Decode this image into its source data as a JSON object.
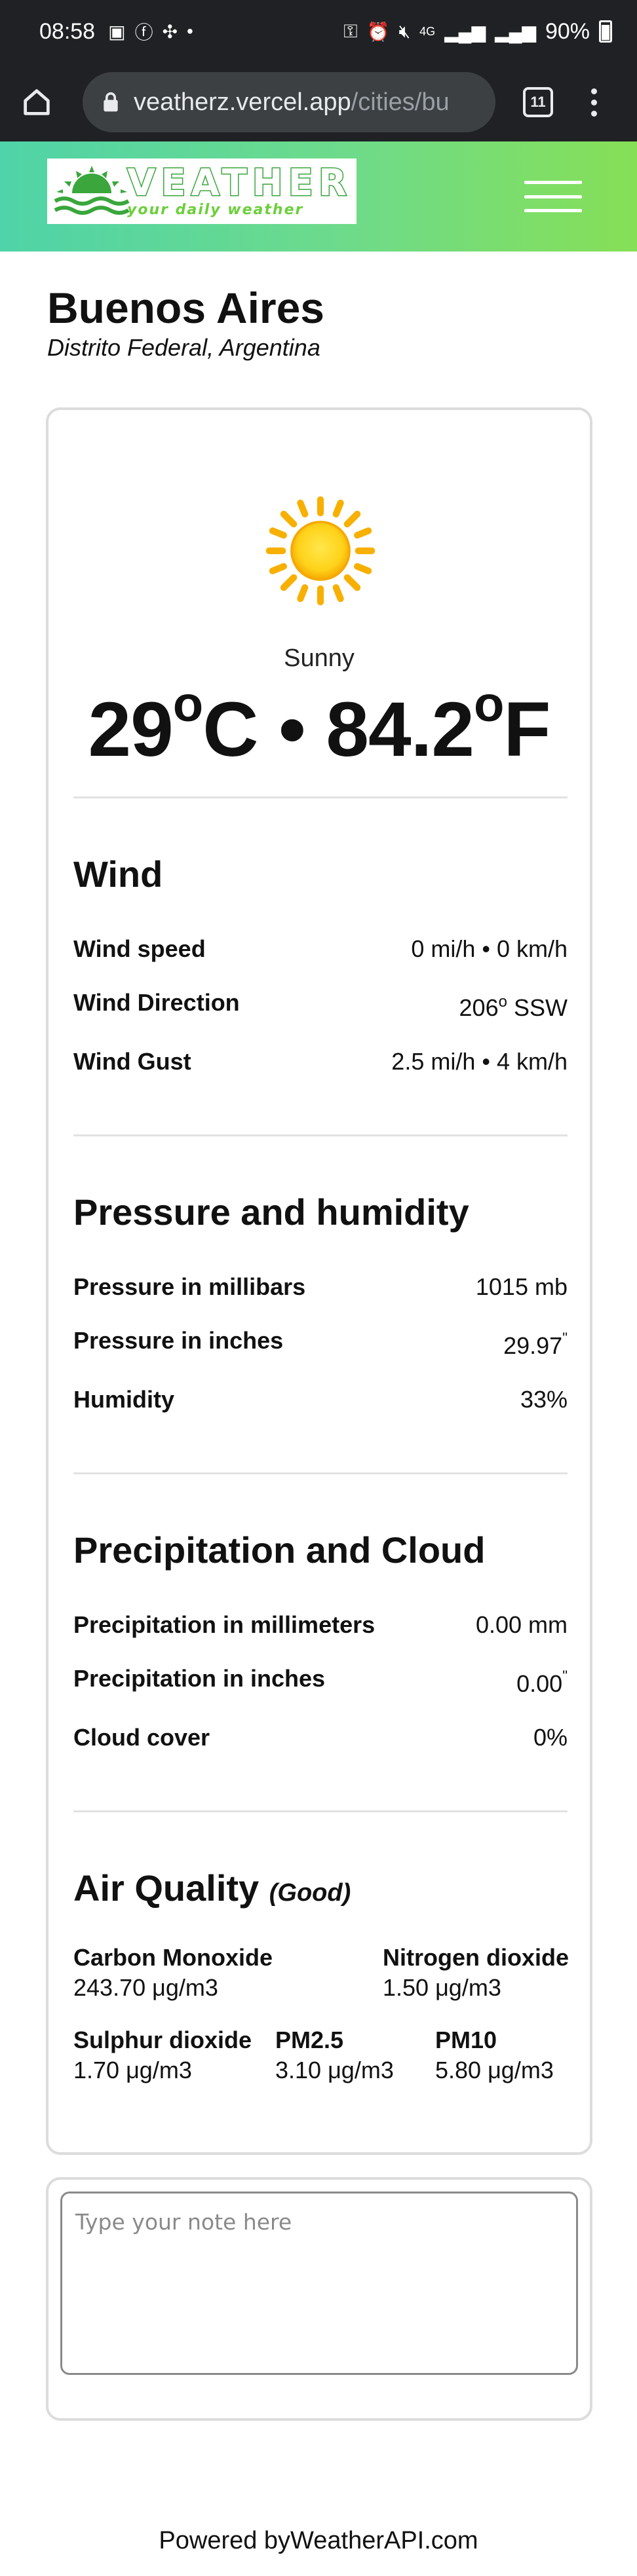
{
  "status_bar": {
    "time": "08:58",
    "battery": "90%",
    "network": "4G"
  },
  "browser": {
    "url_host": "veatherz.vercel.app",
    "url_path": "/cities/bu",
    "tab_count": "11"
  },
  "site": {
    "logo_title": "VEATHER",
    "logo_tagline": "your daily weather",
    "accent_start": "#4fd3a8",
    "accent_end": "#86df56"
  },
  "city": {
    "name": "Buenos Aires",
    "region": "Distrito Federal, Argentina"
  },
  "current": {
    "icon": "sun-icon",
    "condition": "Sunny",
    "temp_c": "29",
    "unit_c": "C",
    "separator": "•",
    "temp_f": "84.2",
    "unit_f": "F"
  },
  "wind": {
    "title": "Wind",
    "speed_label": "Wind speed",
    "speed_value": "0 mi/h • 0 km/h",
    "direction_label": "Wind Direction",
    "direction_degrees": "206",
    "direction_compass": "SSW",
    "gust_label": "Wind Gust",
    "gust_value": "2.5 mi/h • 4 km/h"
  },
  "pressure": {
    "title": "Pressure and humidity",
    "mb_label": "Pressure in millibars",
    "mb_value": "1015 mb",
    "in_label": "Pressure in inches",
    "in_value": "29.97",
    "in_mark": "\"",
    "humidity_label": "Humidity",
    "humidity_value": "33%"
  },
  "precipitation": {
    "title": "Precipitation and Cloud",
    "mm_label": "Precipitation in millimeters",
    "mm_value": "0.00 mm",
    "in_label": "Precipitation in inches",
    "in_value": "0.00",
    "in_mark": "\"",
    "cloud_label": "Cloud cover",
    "cloud_value": "0%"
  },
  "air_quality": {
    "title": "Air Quality",
    "level": "(Good)",
    "co_label": "Carbon Monoxide",
    "co_value": "243.70 μg/m3",
    "no2_label": "Nitrogen dioxide",
    "no2_value": "1.50 μg/m3",
    "so2_label": "Sulphur dioxide",
    "so2_value": "1.70 μg/m3",
    "pm25_label": "PM2.5",
    "pm25_value": "3.10 μg/m3",
    "pm10_label": "PM10",
    "pm10_value": "5.80 μg/m3"
  },
  "notes": {
    "placeholder": "Type your note here",
    "value": ""
  },
  "footer": {
    "text": "Powered byWeatherAPI.com"
  }
}
